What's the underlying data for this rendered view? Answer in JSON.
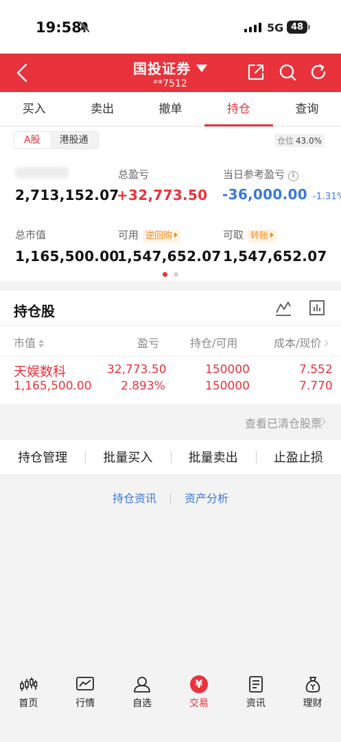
{
  "status_bar": {
    "time": "19:58",
    "network": "5G",
    "battery": "48"
  },
  "header": {
    "title": "国投证券",
    "account": "**7512"
  },
  "tabs": [
    "买入",
    "卖出",
    "撤单",
    "持仓",
    "查询"
  ],
  "active_tab": "持仓",
  "summary": {
    "markets": [
      "A股",
      "港股通"
    ],
    "active_market": "A股",
    "position_ratio_label": "仓位",
    "position_ratio": "43.0%",
    "total_assets": "2,713,152.07",
    "total_pnl_label": "总盈亏",
    "total_pnl": "+32,773.50",
    "day_pnl_label": "当日参考盈亏",
    "day_pnl": "-36,000.00",
    "day_pnl_pct": "-1.31%",
    "market_value_label": "总市值",
    "market_value": "1,165,500.00",
    "available_label": "可用",
    "available_tag": "逆回购",
    "available": "1,547,652.07",
    "withdrawable_label": "可取",
    "withdrawable_tag": "转账",
    "withdrawable": "1,547,652.07"
  },
  "holdings": {
    "title": "持仓股",
    "columns": [
      "市值",
      "盈亏",
      "持仓/可用",
      "成本/现价"
    ],
    "rows": [
      {
        "name": "天娱数科",
        "market_value": "1,165,500.00",
        "pnl": "32,773.50",
        "pnl_pct": "2.893%",
        "position": "150000",
        "available": "150000",
        "cost": "7.552",
        "price": "7.770"
      }
    ],
    "cleared_link": "查看已清仓股票"
  },
  "actions": [
    "持仓管理",
    "批量买入",
    "批量卖出",
    "止盈止损"
  ],
  "links": [
    "持仓资讯",
    "资产分析"
  ],
  "bottom_nav": [
    {
      "label": "首页",
      "icon": "candlestick-icon"
    },
    {
      "label": "行情",
      "icon": "chart-line-icon"
    },
    {
      "label": "自选",
      "icon": "user-icon"
    },
    {
      "label": "交易",
      "icon": "yen-icon"
    },
    {
      "label": "资讯",
      "icon": "document-icon"
    },
    {
      "label": "理财",
      "icon": "money-bag-icon"
    }
  ],
  "active_nav": "交易",
  "colors": {
    "brand_red": "#e8323c",
    "loss_blue": "#3a78d6",
    "tag_orange": "#f08a1c"
  }
}
